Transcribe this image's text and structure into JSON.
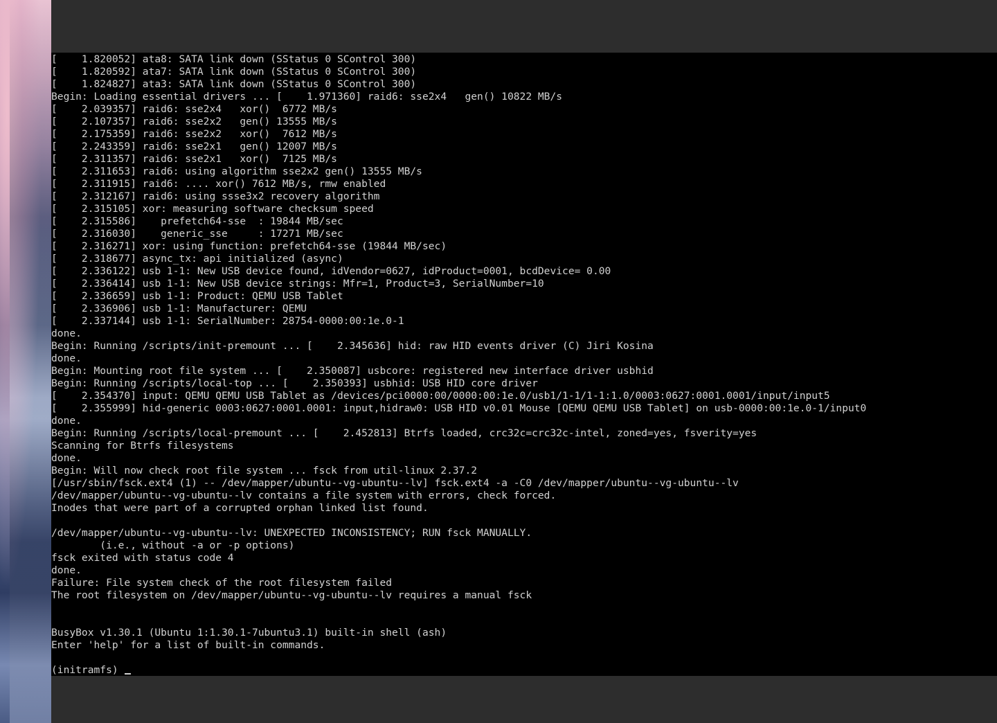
{
  "console": {
    "lines": [
      "[    1.820052] ata8: SATA link down (SStatus 0 SControl 300)",
      "[    1.820592] ata7: SATA link down (SStatus 0 SControl 300)",
      "[    1.824827] ata3: SATA link down (SStatus 0 SControl 300)",
      "Begin: Loading essential drivers ... [    1.971360] raid6: sse2x4   gen() 10822 MB/s",
      "[    2.039357] raid6: sse2x4   xor()  6772 MB/s",
      "[    2.107357] raid6: sse2x2   gen() 13555 MB/s",
      "[    2.175359] raid6: sse2x2   xor()  7612 MB/s",
      "[    2.243359] raid6: sse2x1   gen() 12007 MB/s",
      "[    2.311357] raid6: sse2x1   xor()  7125 MB/s",
      "[    2.311653] raid6: using algorithm sse2x2 gen() 13555 MB/s",
      "[    2.311915] raid6: .... xor() 7612 MB/s, rmw enabled",
      "[    2.312167] raid6: using ssse3x2 recovery algorithm",
      "[    2.315105] xor: measuring software checksum speed",
      "[    2.315586]    prefetch64-sse  : 19844 MB/sec",
      "[    2.316030]    generic_sse     : 17271 MB/sec",
      "[    2.316271] xor: using function: prefetch64-sse (19844 MB/sec)",
      "[    2.318677] async_tx: api initialized (async)",
      "[    2.336122] usb 1-1: New USB device found, idVendor=0627, idProduct=0001, bcdDevice= 0.00",
      "[    2.336414] usb 1-1: New USB device strings: Mfr=1, Product=3, SerialNumber=10",
      "[    2.336659] usb 1-1: Product: QEMU USB Tablet",
      "[    2.336906] usb 1-1: Manufacturer: QEMU",
      "[    2.337144] usb 1-1: SerialNumber: 28754-0000:00:1e.0-1",
      "done.",
      "Begin: Running /scripts/init-premount ... [    2.345636] hid: raw HID events driver (C) Jiri Kosina",
      "done.",
      "Begin: Mounting root file system ... [    2.350087] usbcore: registered new interface driver usbhid",
      "Begin: Running /scripts/local-top ... [    2.350393] usbhid: USB HID core driver",
      "[    2.354370] input: QEMU QEMU USB Tablet as /devices/pci0000:00/0000:00:1e.0/usb1/1-1/1-1:1.0/0003:0627:0001.0001/input/input5",
      "[    2.355999] hid-generic 0003:0627:0001.0001: input,hidraw0: USB HID v0.01 Mouse [QEMU QEMU USB Tablet] on usb-0000:00:1e.0-1/input0",
      "done.",
      "Begin: Running /scripts/local-premount ... [    2.452813] Btrfs loaded, crc32c=crc32c-intel, zoned=yes, fsverity=yes",
      "Scanning for Btrfs filesystems",
      "done.",
      "Begin: Will now check root file system ... fsck from util-linux 2.37.2",
      "[/usr/sbin/fsck.ext4 (1) -- /dev/mapper/ubuntu--vg-ubuntu--lv] fsck.ext4 -a -C0 /dev/mapper/ubuntu--vg-ubuntu--lv",
      "/dev/mapper/ubuntu--vg-ubuntu--lv contains a file system with errors, check forced.",
      "Inodes that were part of a corrupted orphan linked list found.",
      "",
      "/dev/mapper/ubuntu--vg-ubuntu--lv: UNEXPECTED INCONSISTENCY; RUN fsck MANUALLY.",
      "        (i.e., without -a or -p options)",
      "fsck exited with status code 4",
      "done.",
      "Failure: File system check of the root filesystem failed",
      "The root filesystem on /dev/mapper/ubuntu--vg-ubuntu--lv requires a manual fsck",
      "",
      "",
      "BusyBox v1.30.1 (Ubuntu 1:1.30.1-7ubuntu3.1) built-in shell (ash)",
      "Enter 'help' for a list of built-in commands.",
      ""
    ],
    "prompt": "(initramfs) "
  },
  "colors": {
    "console_background": "#000000",
    "console_text": "#d2d2d2",
    "window_chrome": "#2d2d2d"
  }
}
